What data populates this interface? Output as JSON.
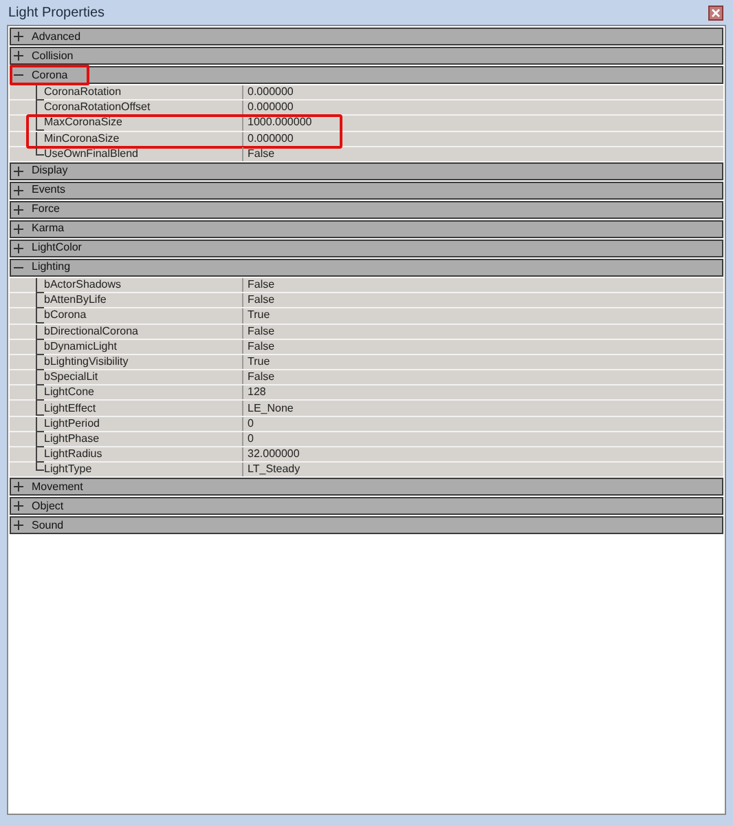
{
  "window": {
    "title": "Light Properties"
  },
  "categories": [
    {
      "label": "Advanced",
      "expanded": false,
      "highlighted": false
    },
    {
      "label": "Collision",
      "expanded": false,
      "highlighted": false
    },
    {
      "label": "Corona",
      "expanded": true,
      "highlighted": true,
      "properties": [
        {
          "name": "CoronaRotation",
          "value": "0.000000",
          "highlighted": false
        },
        {
          "name": "CoronaRotationOffset",
          "value": "0.000000",
          "highlighted": false
        },
        {
          "name": "MaxCoronaSize",
          "value": "1000.000000",
          "highlighted": true
        },
        {
          "name": "MinCoronaSize",
          "value": "0.000000",
          "highlighted": true
        },
        {
          "name": "UseOwnFinalBlend",
          "value": "False",
          "highlighted": false
        }
      ]
    },
    {
      "label": "Display",
      "expanded": false,
      "highlighted": false
    },
    {
      "label": "Events",
      "expanded": false,
      "highlighted": false
    },
    {
      "label": "Force",
      "expanded": false,
      "highlighted": false
    },
    {
      "label": "Karma",
      "expanded": false,
      "highlighted": false
    },
    {
      "label": "LightColor",
      "expanded": false,
      "highlighted": false
    },
    {
      "label": "Lighting",
      "expanded": true,
      "highlighted": false,
      "properties": [
        {
          "name": "bActorShadows",
          "value": "False",
          "highlighted": false
        },
        {
          "name": "bAttenByLife",
          "value": "False",
          "highlighted": false
        },
        {
          "name": "bCorona",
          "value": "True",
          "highlighted": false
        },
        {
          "name": "bDirectionalCorona",
          "value": "False",
          "highlighted": false
        },
        {
          "name": "bDynamicLight",
          "value": "False",
          "highlighted": false
        },
        {
          "name": "bLightingVisibility",
          "value": "True",
          "highlighted": false
        },
        {
          "name": "bSpecialLit",
          "value": "False",
          "highlighted": false
        },
        {
          "name": "LightCone",
          "value": "128",
          "highlighted": false
        },
        {
          "name": "LightEffect",
          "value": "LE_None",
          "highlighted": false
        },
        {
          "name": "LightPeriod",
          "value": "0",
          "highlighted": false
        },
        {
          "name": "LightPhase",
          "value": "0",
          "highlighted": false
        },
        {
          "name": "LightRadius",
          "value": "32.000000",
          "highlighted": false
        },
        {
          "name": "LightType",
          "value": "LT_Steady",
          "highlighted": false
        }
      ]
    },
    {
      "label": "Movement",
      "expanded": false,
      "highlighted": false
    },
    {
      "label": "Object",
      "expanded": false,
      "highlighted": false
    },
    {
      "label": "Sound",
      "expanded": false,
      "highlighted": false
    }
  ]
}
